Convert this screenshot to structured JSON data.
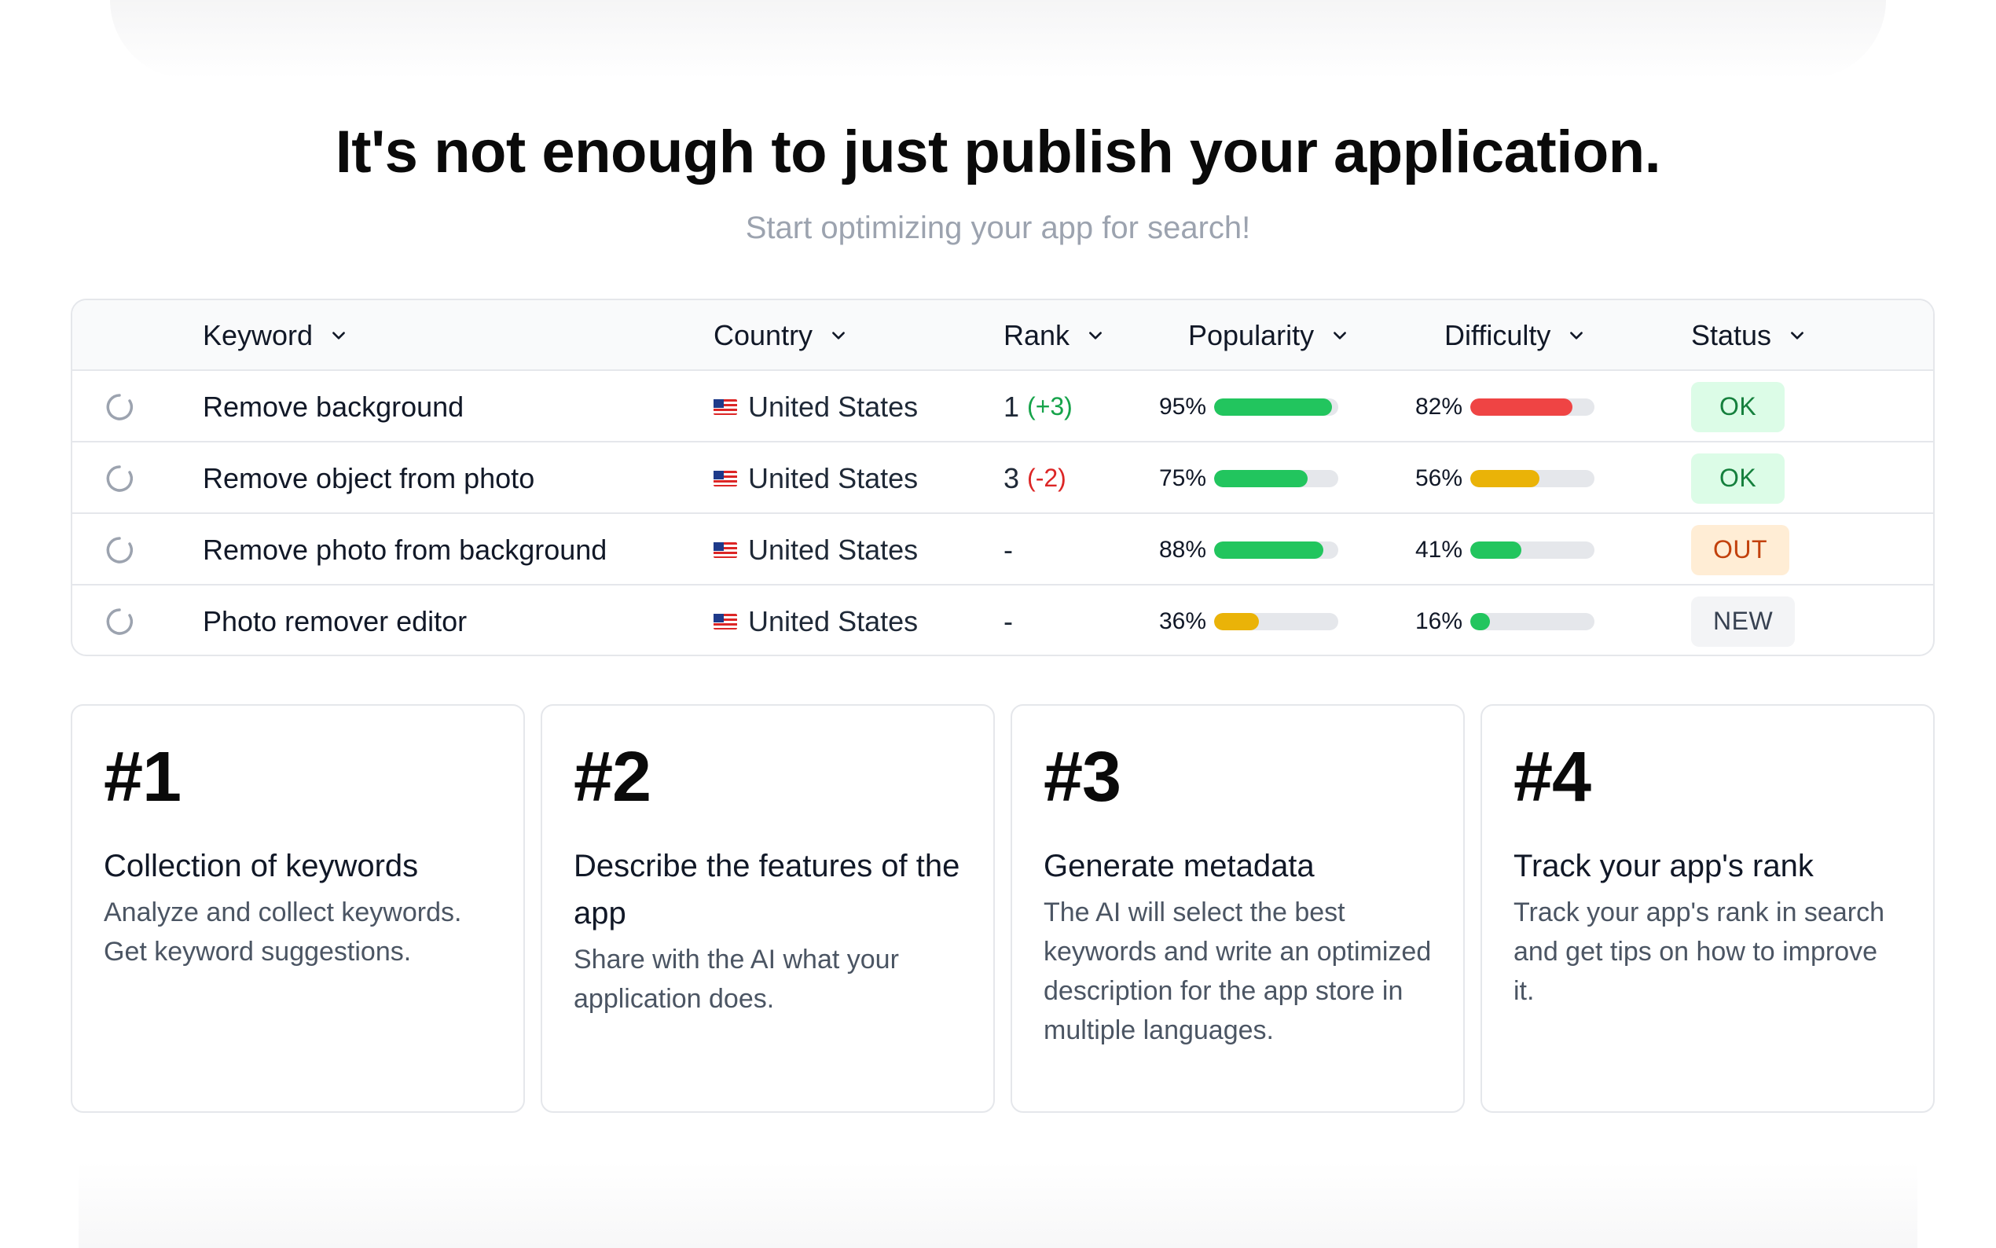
{
  "hero": {
    "title": "It's not enough to just publish your application.",
    "subtitle": "Start optimizing your app for search!"
  },
  "table": {
    "columns": [
      "Keyword",
      "Country",
      "Rank",
      "Popularity",
      "Difficulty",
      "Status"
    ],
    "rows": [
      {
        "keyword": "Remove background",
        "country": "United States",
        "rank": "1",
        "delta": "(+3)",
        "popularity": "95%",
        "difficulty": "82%",
        "status": "OK"
      },
      {
        "keyword": "Remove object from photo",
        "country": "United States",
        "rank": "3",
        "delta": "(-2)",
        "popularity": "75%",
        "difficulty": "56%",
        "status": "OK"
      },
      {
        "keyword": "Remove photo from background",
        "country": "United States",
        "rank": "-",
        "delta": "",
        "popularity": "88%",
        "difficulty": "41%",
        "status": "OUT"
      },
      {
        "keyword": "Photo remover editor",
        "country": "United States",
        "rank": "-",
        "delta": "",
        "popularity": "36%",
        "difficulty": "16%",
        "status": "NEW"
      }
    ],
    "colors": {
      "green": "#22c55e",
      "amber": "#eab308",
      "red": "#ef4444",
      "track": "#e5e7eb"
    }
  },
  "features": [
    {
      "num": "#1",
      "title": "Collection of keywords",
      "text": "Analyze and collect keywords. Get keyword suggestions."
    },
    {
      "num": "#2",
      "title": "Describe the features of the app",
      "text": "Share with the AI what your application does."
    },
    {
      "num": "#3",
      "title": "Generate metadata",
      "text": "The AI will select the best keywords and write an optimized description for the app store in multiple languages."
    },
    {
      "num": "#4",
      "title": "Track your app's rank",
      "text": "Track your app's rank in search and get tips on how to improve it."
    }
  ]
}
